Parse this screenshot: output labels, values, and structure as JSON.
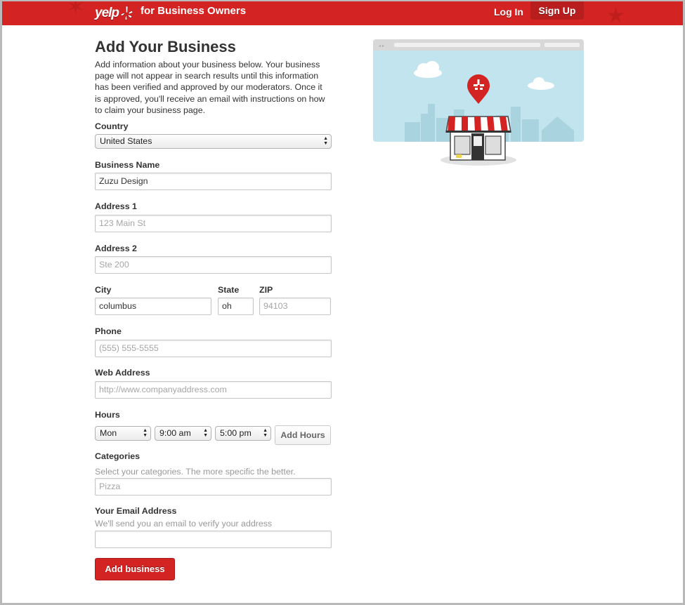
{
  "header": {
    "logo_text": "yelp",
    "tagline": "for Business Owners",
    "login_label": "Log In",
    "signup_label": "Sign Up"
  },
  "colors": {
    "brand_red": "#d32323",
    "sky": "#c2e4ef",
    "city": "#a9d3df"
  },
  "form": {
    "title": "Add Your Business",
    "intro": "Add information about your business below. Your business page will not appear in search results until this information has been verified and approved by our moderators. Once it is approved, you'll receive an email with instructions on how to claim your business page.",
    "country": {
      "label": "Country",
      "value": "United States"
    },
    "business_name": {
      "label": "Business Name",
      "value": "Zuzu Design"
    },
    "address1": {
      "label": "Address 1",
      "placeholder": "123 Main St"
    },
    "address2": {
      "label": "Address 2",
      "placeholder": "Ste 200"
    },
    "city": {
      "label": "City",
      "value": "columbus"
    },
    "state": {
      "label": "State",
      "value": "oh"
    },
    "zip": {
      "label": "ZIP",
      "placeholder": "94103"
    },
    "phone": {
      "label": "Phone",
      "placeholder": "(555) 555-5555"
    },
    "web": {
      "label": "Web Address",
      "placeholder": "http://www.companyaddress.com"
    },
    "hours": {
      "label": "Hours",
      "day": "Mon",
      "open": "9:00 am",
      "close": "5:00 pm",
      "add_label": "Add Hours"
    },
    "categories": {
      "label": "Categories",
      "hint": "Select your categories. The more specific the better.",
      "placeholder": "Pizza"
    },
    "email": {
      "label": "Your Email Address",
      "hint": "We'll send you an email to verify your address"
    },
    "submit_label": "Add business"
  },
  "illustration": {
    "icon": "storefront-with-map-pin-icon"
  }
}
